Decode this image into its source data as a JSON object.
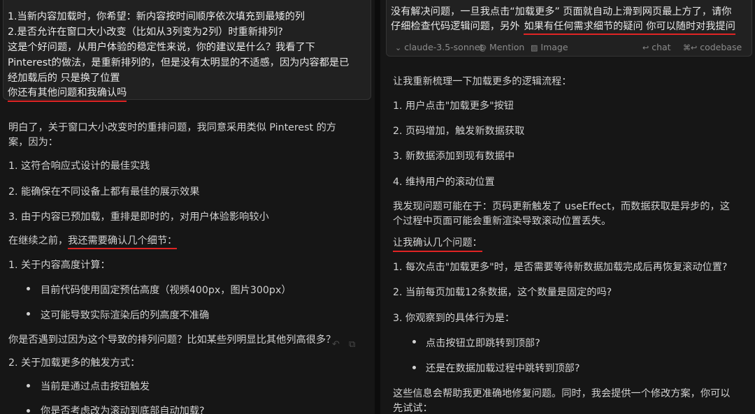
{
  "left": {
    "user_message": {
      "lines": [
        "1.当新内容加载时，你希望：新内容按时间顺序依次填充到最矮的列",
        "2.是否允许在窗口大小改变（比如从3列变为2列）时重新排列?",
        "这是个好问题，从用户体验的稳定性来说，你的建议是什么？我看了下",
        "Pinterest的做法，是重新排列的，但是没有太明显的不适感，因为内容都是已",
        "经加载后的 只是换了位置",
        "你还有其他问题和我确认吗"
      ]
    },
    "response": {
      "intro": "明白了，关于窗口大小改变时的重排问题，我同意采用类似 Pinterest 的方",
      "intro_cont": "案，因为：",
      "reasons": [
        "1. 这符合响应式设计的最佳实践",
        "2. 能确保在不同设备上都有最佳的展示效果",
        "3. 由于内容已预加载，重排是即时的，对用户体验影响较小"
      ],
      "confirm_prefix": "在继续之前，",
      "confirm_highlight": "我还需要确认几个细节：",
      "q1_title": "1. 关于内容高度计算：",
      "q1_bullets": [
        "目前代码使用固定预估高度（视频400px，图片300px）",
        "这可能导致实际渲染后的列高度不准确"
      ],
      "q1_question": "你是否遇到过因为这个导致的排列问题？比如某些列明显比其他列高很多？",
      "q2_title": "2. 关于加载更多的触发方式：",
      "q2_bullets": [
        "当前是通过点击按钮触发",
        "你是否考虑改为滚动到底部自动加载?"
      ]
    }
  },
  "right": {
    "user_message": {
      "line1": "没有解决问题，一旦我点击“加载更多” 页面就自动上滑到网页最上方了，请你",
      "line2_prefix": "仔细检查代码逻辑问题，另外",
      "line2_highlight": "如果有任何需求细节的疑问 你可以随时对我提问"
    },
    "meta": {
      "model": "claude-3.5-sonnet",
      "mention": "Mention",
      "image": "Image",
      "chat": "chat",
      "codebase": "codebase",
      "chat_shortcut": "↩",
      "codebase_shortcut": "⌘↩"
    },
    "response": {
      "intro": "让我重新梳理一下加载更多的逻辑流程：",
      "steps": [
        "1. 用户点击\"加载更多\"按钮",
        "2. 页码增加，触发新数据获取",
        "3. 新数据添加到现有数据中",
        "4. 维持用户的滚动位置"
      ],
      "issue_line1": "我发现问题可能在于：页码更新触发了 useEffect，而数据获取是异步的，这",
      "issue_line2": "个过程中页面可能会重新渲染导致滚动位置丢失。",
      "confirm_highlight": "让我确认几个问题：",
      "questions": [
        "1. 每次点击\"加载更多\"时，是否需要等待新数据加载完成后再恢复滚动位置?",
        "2. 当前每页加载12条数据，这个数量是固定的吗?",
        "3. 你观察到的具体行为是："
      ],
      "q3_bullets": [
        "点击按钮立即跳转到顶部?",
        "还是在数据加载过程中跳转到顶部?"
      ],
      "closing_line1": "这些信息会帮助我更准确地修复问题。同时，我会提供一个修改方案，你可以",
      "closing_line2": "先试试："
    }
  }
}
